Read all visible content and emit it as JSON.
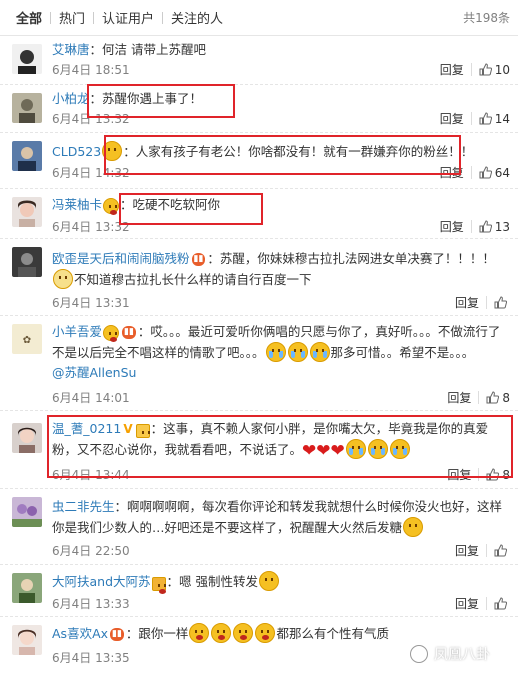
{
  "tabs": [
    {
      "label": "全部"
    },
    {
      "label": "热门"
    },
    {
      "label": "认证用户"
    },
    {
      "label": "关注的人"
    }
  ],
  "total_label": "共198条",
  "action_reply": "回复",
  "comments": [
    {
      "user": "艾琳唐",
      "text": "：何洁  请带上苏醒吧",
      "time": "6月4日 18:51",
      "likes": "10"
    },
    {
      "user": "小柏龙",
      "text": "：苏醒你遇上事了！",
      "time": "6月4日 13:32",
      "likes": "14"
    },
    {
      "user": "CLD523",
      "text": "：人家有孩子有老公！你啥都没有！就有一群嫌弃你的粉丝！！",
      "time": "6月4日 14:32",
      "likes": "64"
    },
    {
      "user": "冯莱柚卡",
      "text": "：吃硬不吃软阿你",
      "time": "6月4日 13:32",
      "likes": "13"
    },
    {
      "user": "欧歪是天后和闹闹脑残粉",
      "text": "：苏醒，你妹妹穆古拉扎法网进女单决赛了！！！！",
      "text2": "不知道穆古拉扎长什么样的请自行百度一下",
      "time": "6月4日 13:31",
      "likes": ""
    },
    {
      "user": "小羊吾爱",
      "text": "：哎。。。最近可爱听你俩唱的只愿与你了，真好听。。。不做流行了不是以后完全不唱这样的情歌了吧。。。",
      "text2": "那多可惜。。希望不是。。。",
      "mention": "@苏醒AllenSu",
      "time": "6月4日 14:01",
      "likes": "8"
    },
    {
      "user": "温_蓍_0211",
      "text": "：这事，真不赖人家何小胖，是你嘴太欠，毕竟我是你的真爱粉，又不忍心说你，我就看看吧，不说话了。",
      "time": "6月4日 13:44",
      "likes": "8"
    },
    {
      "user": "虫二非先生",
      "text": "：啊啊啊啊啊，每次看你评论和转发我就想什么时候你没火也好，这样你是我们少数人的…好吧还是不要这样了，祝醒醒大火然后发糖",
      "time": "6月4日 22:50",
      "likes": ""
    },
    {
      "user": "大阿扶and大阿苏",
      "text": "：嗯  强制性转发",
      "time": "6月4日 13:33",
      "likes": ""
    },
    {
      "user": "As喜欢Ax",
      "text": "：跟你一样",
      "text2": "都那么有个性有气质",
      "time": "6月4日 13:35",
      "likes": ""
    }
  ],
  "watermark": "凤凰八卦",
  "colors": {
    "link": "#2e7bb8",
    "highlight_box": "#e0242a",
    "badge": "#e85d2a"
  }
}
